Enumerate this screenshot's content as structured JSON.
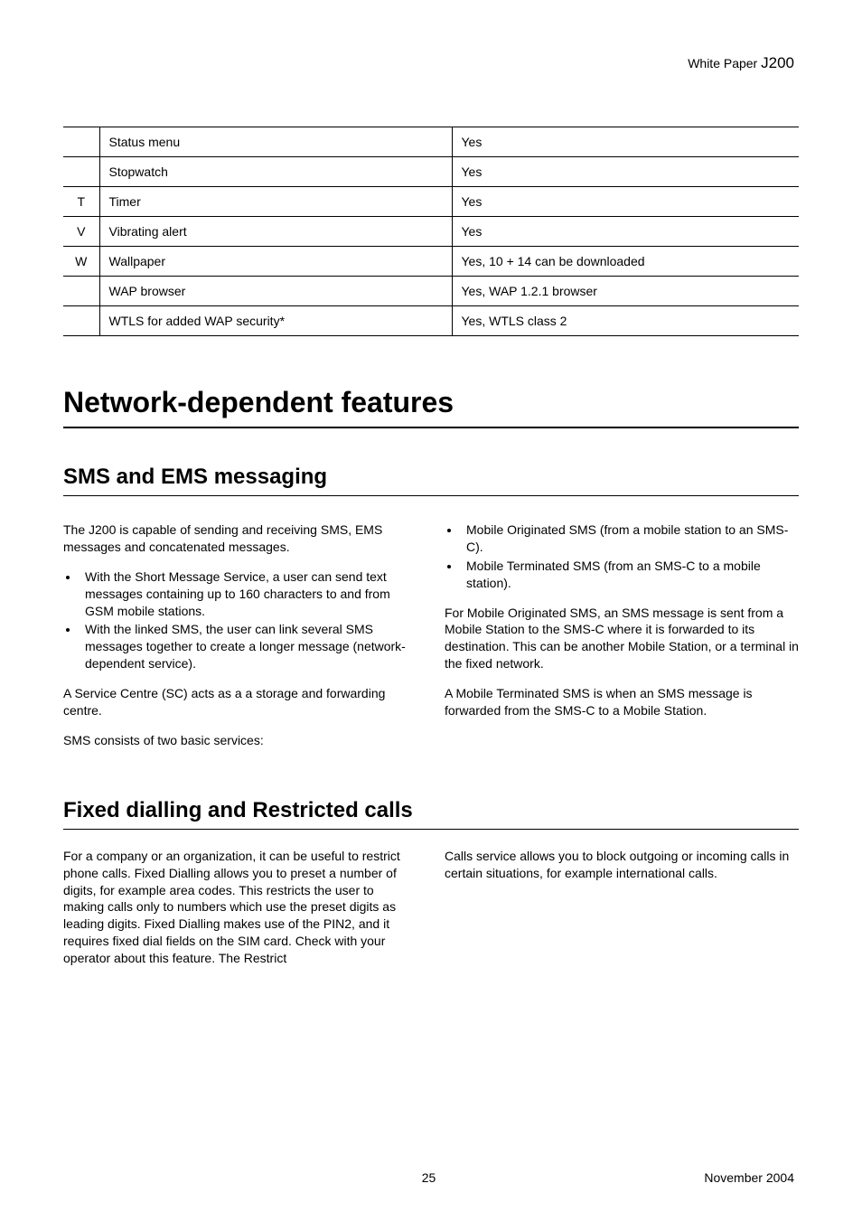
{
  "header": {
    "prefix": "White Paper ",
    "model": "J200"
  },
  "tableRows": [
    {
      "letter": "",
      "feature": "Status menu",
      "value": "Yes"
    },
    {
      "letter": "",
      "feature": "Stopwatch",
      "value": "Yes"
    },
    {
      "letter": "T",
      "feature": "Timer",
      "value": "Yes"
    },
    {
      "letter": "V",
      "feature": "Vibrating alert",
      "value": "Yes"
    },
    {
      "letter": "W",
      "feature": "Wallpaper",
      "value": "Yes, 10 + 14 can be downloaded"
    },
    {
      "letter": "",
      "feature": "WAP browser",
      "value": "Yes, WAP 1.2.1 browser"
    },
    {
      "letter": "",
      "feature": "WTLS for added WAP security*",
      "value": "Yes, WTLS class 2"
    }
  ],
  "h1": "Network-dependent features",
  "section1": {
    "title": "SMS and EMS messaging",
    "col1": {
      "p1": "The J200 is capable of sending and receiving SMS, EMS messages and concatenated messages.",
      "li1": "With the Short Message Service, a user can send text messages containing up to 160 characters to and from GSM mobile stations.",
      "li2": "With the linked SMS, the user can link several SMS messages together to create a longer message (network-dependent service).",
      "p2": "A Service Centre (SC) acts as a a storage and forwarding centre.",
      "p3": "SMS consists of two basic services:"
    },
    "col2": {
      "li1": "Mobile Originated SMS (from a mobile station to an SMS-C).",
      "li2": "Mobile Terminated SMS (from an SMS-C to a mobile station).",
      "p1": "For Mobile Originated SMS, an SMS message is sent from a Mobile Station to the SMS-C where it is forwarded to its destination. This can be another Mobile Station, or a terminal in the fixed network.",
      "p2": "A Mobile Terminated SMS is when an SMS message is forwarded from the SMS-C to a Mobile Station."
    }
  },
  "section2": {
    "title": "Fixed dialling and Restricted calls",
    "col1": {
      "p1": "For a company or an organization, it can be useful to restrict phone calls. Fixed Dialling allows you to preset a number of digits, for example area codes. This restricts the user to making calls only to numbers which use the preset digits as leading digits. Fixed Dialling makes use of the PIN2, and it requires fixed dial fields on the SIM card. Check with your operator about this feature. The Restrict"
    },
    "col2": {
      "p1": "Calls service allows you to block outgoing or incoming calls in certain situations, for example international calls."
    }
  },
  "footer": {
    "page": "25",
    "date": "November 2004"
  }
}
